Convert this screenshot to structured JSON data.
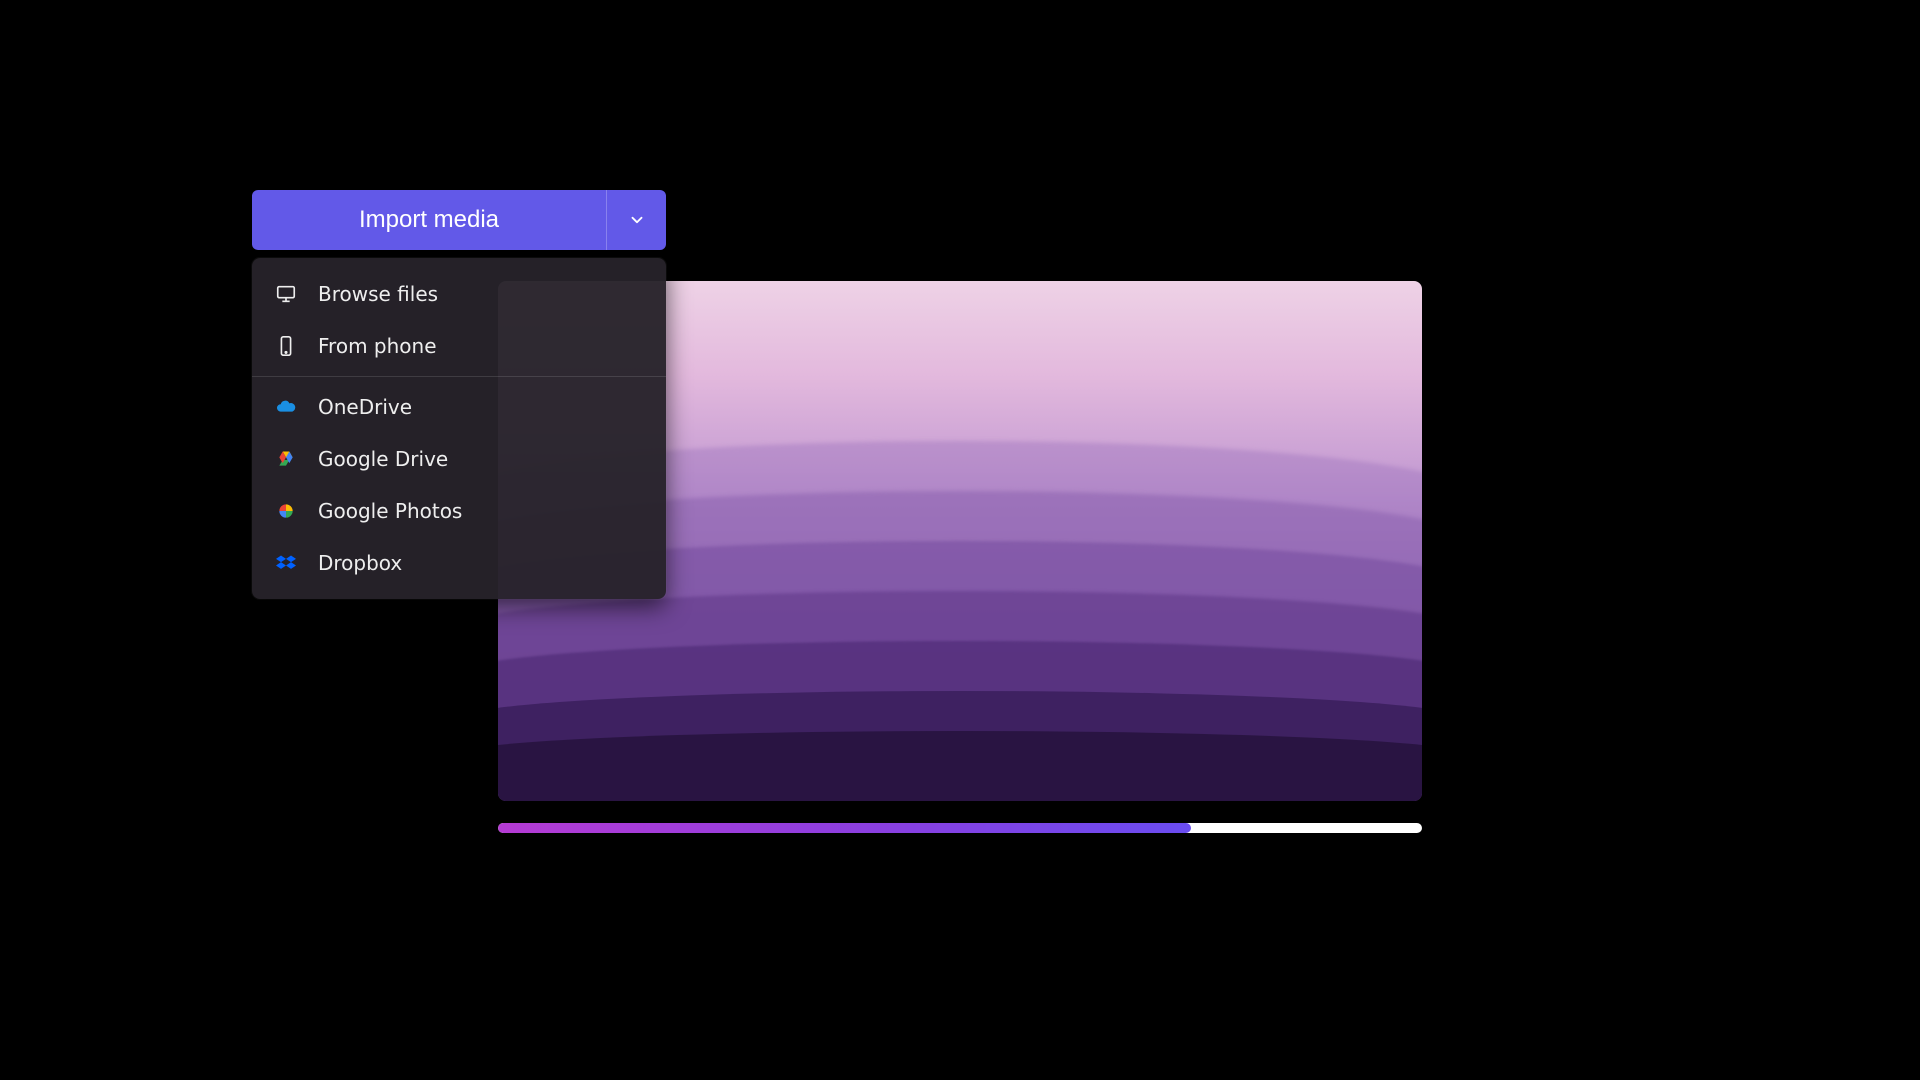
{
  "import_button": {
    "label": "Import media"
  },
  "menu": {
    "items": [
      {
        "label": "Browse files"
      },
      {
        "label": "From phone"
      },
      {
        "label": "OneDrive"
      },
      {
        "label": "Google Drive"
      },
      {
        "label": "Google Photos"
      },
      {
        "label": "Dropbox"
      }
    ]
  },
  "progress": {
    "percent": 75
  },
  "colors": {
    "accent": "#6259e8",
    "dropdown_bg": "#26222a"
  }
}
